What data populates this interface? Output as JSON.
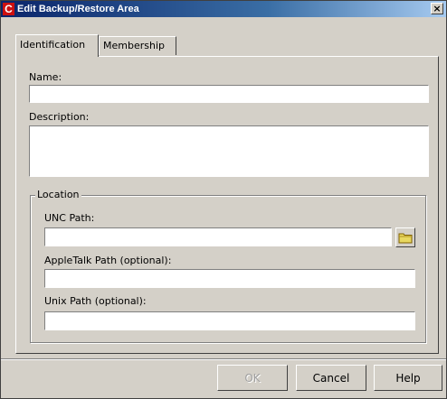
{
  "window": {
    "title": "Edit Backup/Restore Area",
    "app_icon_letter": "C",
    "close_glyph": "×"
  },
  "tabs": [
    {
      "label": "Identification",
      "active": true
    },
    {
      "label": "Membership",
      "active": false
    }
  ],
  "identification": {
    "name_label": "Name:",
    "name_value": "",
    "description_label": "Description:",
    "description_value": ""
  },
  "location": {
    "group_label": "Location",
    "unc_label": "UNC Path:",
    "unc_value": "",
    "appletalk_label": "AppleTalk Path (optional):",
    "appletalk_value": "",
    "unix_label": "Unix Path (optional):",
    "unix_value": "",
    "browse_icon": "folder-icon"
  },
  "buttons": {
    "ok": "OK",
    "ok_enabled": false,
    "cancel": "Cancel",
    "help": "Help"
  },
  "colors": {
    "dialog_bg": "#d4d0c8",
    "title_start": "#0a246a",
    "title_end": "#a6caf0",
    "app_icon": "#cc1010"
  }
}
